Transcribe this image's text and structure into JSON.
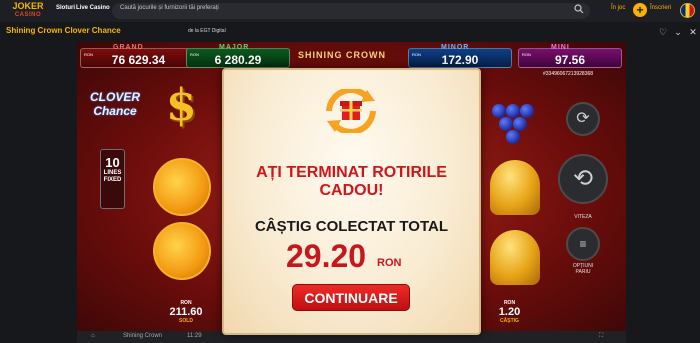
{
  "topbar": {
    "logo_main": "JOKER",
    "logo_sub": "CASINO",
    "nav_sloturi": "Sloturi",
    "nav_live": "Live Casino",
    "search_placeholder": "Caută jocurile și furnizorii tăi preferați",
    "login": "În joc",
    "register": "Înscrieri"
  },
  "titlebar": {
    "title": "Shining Crown Clover Chance",
    "provider": "de la EGT Digital"
  },
  "jackpots": [
    {
      "name": "GRAND",
      "value": "76 629.34",
      "cur": "RON",
      "color": "#f06f6f"
    },
    {
      "name": "MAJOR",
      "value": "6 280.29",
      "cur": "RON",
      "color": "#5ed66a"
    },
    {
      "name": "MINOR",
      "value": "172.90",
      "cur": "RON",
      "color": "#6ab7ff"
    },
    {
      "name": "MINI",
      "value": "97.56",
      "cur": "RON",
      "color": "#ff70e0"
    }
  ],
  "game": {
    "logo": "SHINING CROWN",
    "round_id": "#33496067213928368",
    "clover_1": "CLOVER",
    "clover_2": "Chance",
    "lines_num": "10",
    "lines_t1": "LINES",
    "lines_t2": "FIXED",
    "speed_label": "VITEZA",
    "options_label_1": "OPȚIUNI",
    "options_label_2": "PARIU"
  },
  "bottom": {
    "sold_cur": "RON",
    "sold_val": "211.60",
    "sold_lbl": "SOLD",
    "win_cur": "RON",
    "win_val": "1.20",
    "win_lbl": "CÂȘTIG"
  },
  "taskbar": {
    "game": "Shining Crown",
    "time": "11:29"
  },
  "modal": {
    "heading_1": "AȚI TERMINAT ROTIRILE",
    "heading_2": "CADOU!",
    "total_label": "CÂȘTIG COLECTAT TOTAL",
    "amount": "29.20",
    "currency": "RON",
    "button": "CONTINUARE"
  }
}
